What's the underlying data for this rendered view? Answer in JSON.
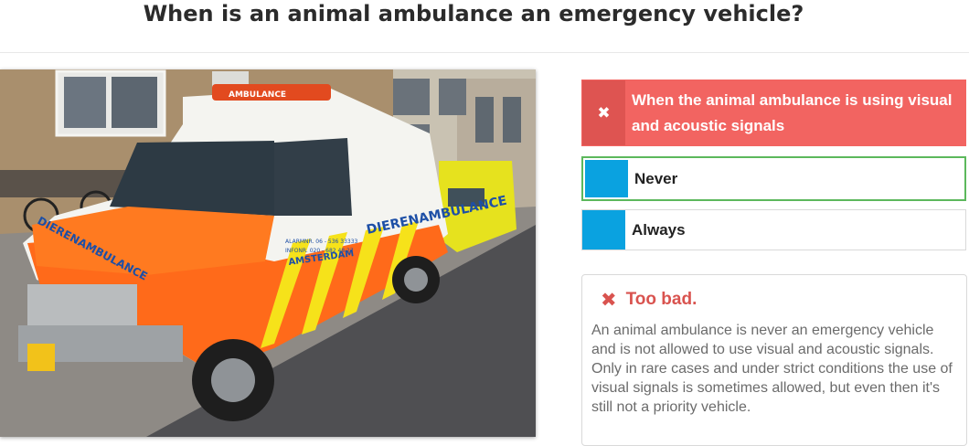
{
  "question": {
    "title": "When is an animal ambulance an emergency vehicle?"
  },
  "image": {
    "description_icon": "van-photo",
    "roof_sign": "AMBULANCE",
    "side_text": "DIERENAMBULANCE",
    "hood_text": "DIERENAMBULANCE",
    "city_text": "AMSTERDAM",
    "alarm_line": "ALARMNR. 06 - 536 33333",
    "info_line": "INFONR. 020 - 682 48 27"
  },
  "answers": [
    {
      "marker": "✖",
      "label": "When the animal ambulance is using visual and acoustic signals",
      "state": "wrong"
    },
    {
      "marker": "",
      "label": "Never",
      "state": "correct"
    },
    {
      "marker": "",
      "label": "Always",
      "state": "plain"
    }
  ],
  "feedback": {
    "icon": "close-icon",
    "heading": "Too bad.",
    "body": "An animal ambulance is never an emergency vehicle and is not allowed to use visual and acoustic signals. Only in rare cases and under strict conditions the use of visual signals is sometimes allowed, but even then it's still not a priority vehicle."
  },
  "colors": {
    "wrong": "#f26461",
    "correct_border": "#5cb85c",
    "marker": "#0aa2e0",
    "feedback_heading": "#d9534f"
  }
}
